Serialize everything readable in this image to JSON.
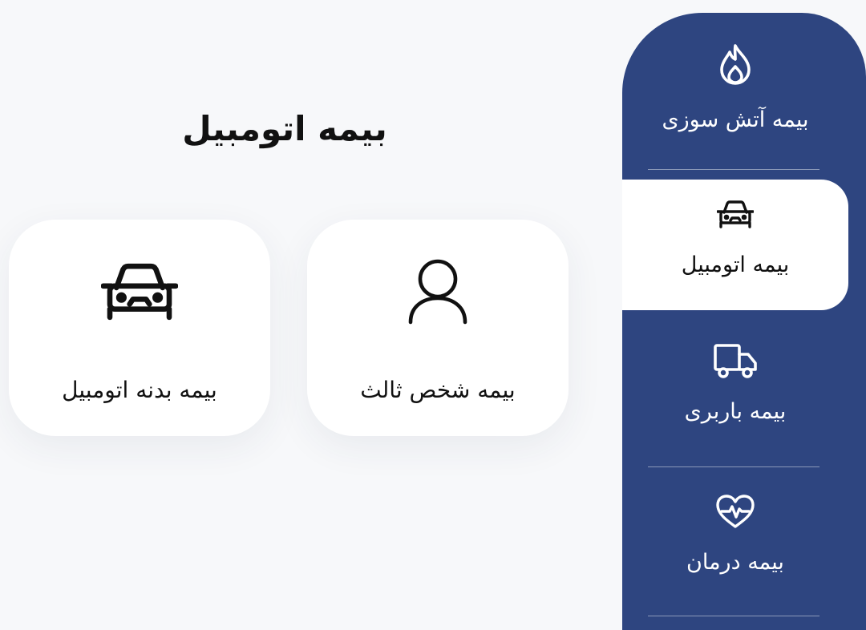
{
  "page_title": "بیمه اتومبیل",
  "colors": {
    "sidebar_bg": "#2e4580",
    "active_item_bg": "#ffffff",
    "page_bg": "#f7f8fa"
  },
  "sidebar": {
    "items": [
      {
        "label": "بیمه آتش سوزی",
        "icon": "flame-icon",
        "active": false
      },
      {
        "label": "بیمه اتومبیل",
        "icon": "car-icon",
        "active": true
      },
      {
        "label": "بیمه باربری",
        "icon": "truck-icon",
        "active": false
      },
      {
        "label": "بیمه درمان",
        "icon": "heart-pulse-icon",
        "active": false
      }
    ]
  },
  "cards": [
    {
      "label": "بیمه شخص ثالث",
      "icon": "person-icon"
    },
    {
      "label": "بیمه بدنه اتومبیل",
      "icon": "car-icon"
    }
  ]
}
